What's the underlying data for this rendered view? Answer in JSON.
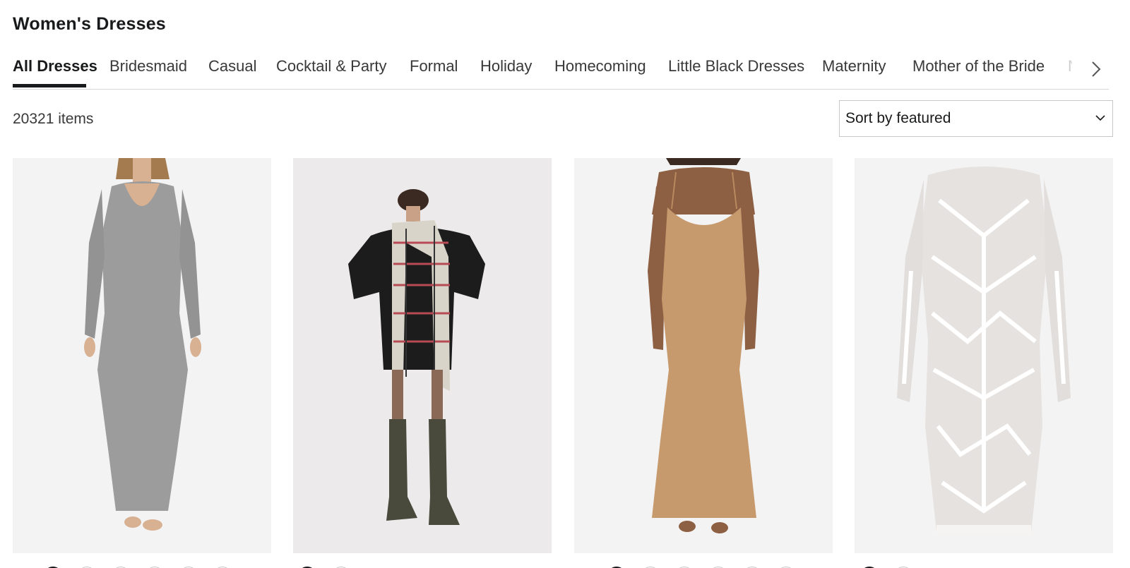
{
  "page": {
    "title": "Women's Dresses"
  },
  "tabs": [
    {
      "label": "All Dresses",
      "active": true
    },
    {
      "label": "Bridesmaid",
      "active": false
    },
    {
      "label": "Casual",
      "active": false
    },
    {
      "label": "Cocktail & Party",
      "active": false
    },
    {
      "label": "Formal",
      "active": false
    },
    {
      "label": "Holiday",
      "active": false
    },
    {
      "label": "Homecoming",
      "active": false
    },
    {
      "label": "Little Black Dresses",
      "active": false
    },
    {
      "label": "Maternity",
      "active": false
    },
    {
      "label": "Mother of the Bride",
      "active": false
    },
    {
      "label": "N",
      "active": false
    }
  ],
  "tabs_next_icon": "chevron-right-icon",
  "results": {
    "count_label": "20321 items"
  },
  "sort": {
    "selected": "Sort by featured",
    "icon": "chevron-down-icon"
  },
  "products": [
    {
      "image": "gray-ribbed-long-sleeve-maxi-dress",
      "dress_color": "#9c9c9c"
    },
    {
      "image": "black-sweater-dress-plaid-scarf-boots",
      "dress_color": "#1c1c1c"
    },
    {
      "image": "tan-slip-maxi-dress",
      "dress_color": "#c79a6e"
    },
    {
      "image": "white-sequin-long-sleeve-midi-dress",
      "dress_color": "#ececec"
    }
  ],
  "colors": {
    "text": "#191a1b",
    "border": "#d6d6d6",
    "image_bg": "#f3f3f3"
  }
}
